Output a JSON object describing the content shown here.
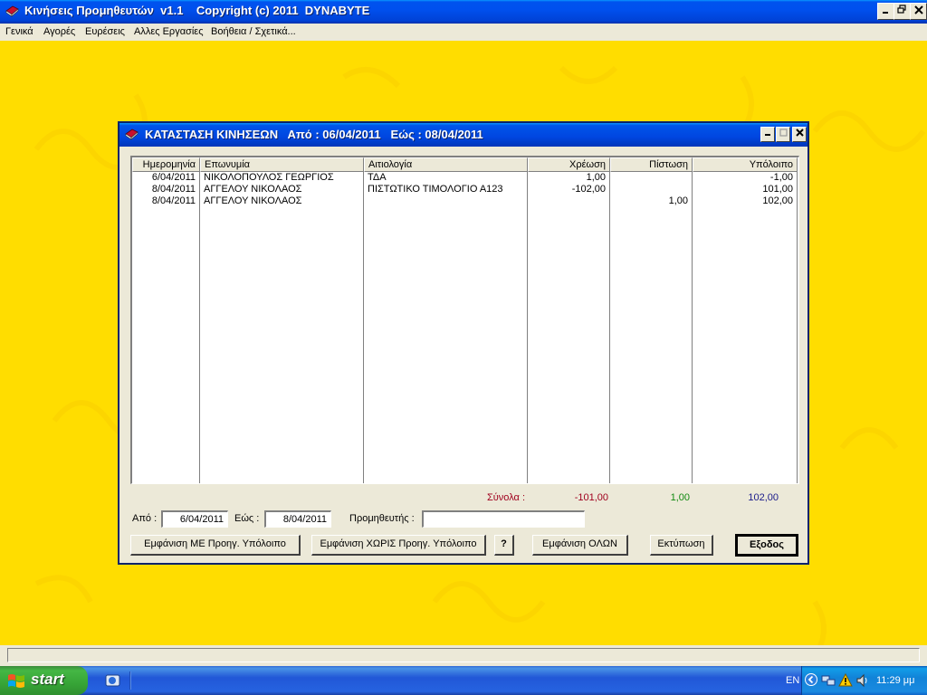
{
  "window": {
    "title": "Κινήσεις Προμηθευτών  v1.1    Copyright (c) 2011  DYNABYTE",
    "icon": "book-icon"
  },
  "menu": {
    "items": [
      {
        "label": "Γενικά"
      },
      {
        "label": "Αγορές"
      },
      {
        "label": "Ευρέσεις"
      },
      {
        "label": "Αλλες Εργασίες"
      },
      {
        "label": "Βοήθεια / Σχετικά..."
      }
    ]
  },
  "dialog": {
    "title": "ΚΑΤΑΣΤΑΣΗ ΚΙΝΗΣΕΩΝ   Από : 06/04/2011   Εώς : 08/04/2011",
    "columns": [
      {
        "label": "Ημερομηνία"
      },
      {
        "label": "Επωνυμία"
      },
      {
        "label": "Αιτιολογία"
      },
      {
        "label": "Χρέωση"
      },
      {
        "label": "Πίστωση"
      },
      {
        "label": "Υπόλοιπο"
      }
    ],
    "rows": [
      {
        "date": "6/04/2011",
        "name": "ΝΙΚΟΛΟΠΟΥΛΟΣ ΓΕΩΡΓΙΟΣ",
        "reason": "ΤΔΑ",
        "debit": "1,00",
        "credit": "",
        "balance": "-1,00"
      },
      {
        "date": "8/04/2011",
        "name": "ΑΓΓΕΛΟΥ ΝΙΚΟΛΑΟΣ",
        "reason": "ΠΙΣΤΩΤΙΚΟ ΤΙΜΟΛΟΓΙΟ  Α123",
        "debit": "-102,00",
        "credit": "",
        "balance": "101,00"
      },
      {
        "date": "8/04/2011",
        "name": "ΑΓΓΕΛΟΥ ΝΙΚΟΛΑΟΣ",
        "reason": "",
        "debit": "",
        "credit": "1,00",
        "balance": "102,00"
      }
    ],
    "totals": {
      "label": "Σύνολα :",
      "debit": "-101,00",
      "credit": "1,00",
      "balance": "102,00",
      "label_color": "#a0001e",
      "debit_color": "#a0001e",
      "credit_color": "#118a11",
      "balance_color": "#1a1a8a"
    },
    "filters": {
      "from_label": "Από :",
      "from_value": "6/04/2011",
      "to_label": "Εώς :",
      "to_value": "8/04/2011",
      "supplier_label": "Προμηθευτής :",
      "supplier_value": ""
    },
    "buttons": {
      "with_balance": "Εμφάνιση ΜΕ Προηγ. Υπόλοιπο",
      "without_balance": "Εμφάνιση ΧΩΡΙΣ Προηγ. Υπόλοιπο",
      "help": "?",
      "show_all": "Εμφάνιση ΟΛΩΝ",
      "print": "Εκτύπωση",
      "exit": "Εξοδος"
    }
  },
  "taskbar": {
    "start_label": "start",
    "language": "EN",
    "clock": "11:29 μμ"
  },
  "colors": {
    "desktop": "#ffdd00",
    "titlebar": "#0050ee",
    "start": "#37a537"
  }
}
